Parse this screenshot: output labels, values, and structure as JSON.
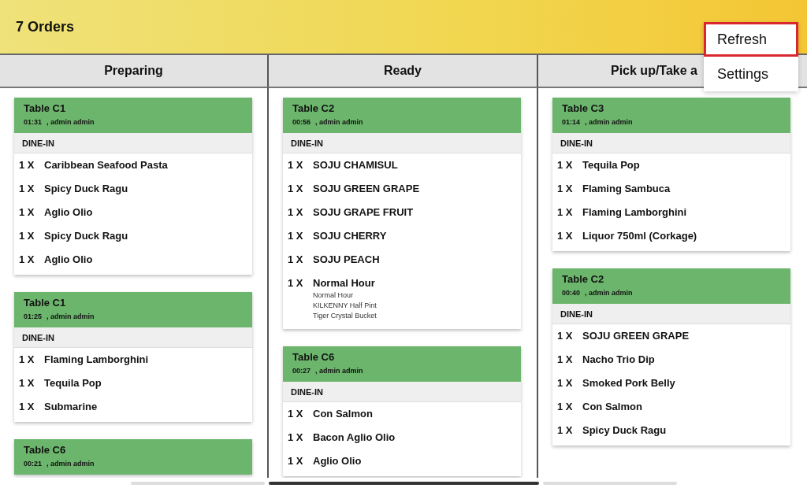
{
  "header": {
    "title": "7 Orders"
  },
  "menu": [
    {
      "label": "Refresh",
      "selected": true
    },
    {
      "label": "Settings",
      "selected": false
    }
  ],
  "columns": [
    {
      "heading": "Preparing",
      "orders": [
        {
          "table": "Table C1",
          "time": "01:31",
          "staff": ", admin admin",
          "type": "DINE-IN",
          "items": [
            {
              "qty": "1 X",
              "name": "Caribbean Seafood Pasta"
            },
            {
              "qty": "1 X",
              "name": "Spicy Duck Ragu"
            },
            {
              "qty": "1 X",
              "name": "Aglio Olio"
            },
            {
              "qty": "1 X",
              "name": "Spicy Duck Ragu"
            },
            {
              "qty": "1 X",
              "name": "Aglio Olio"
            }
          ]
        },
        {
          "table": "Table C1",
          "time": "01:25",
          "staff": ", admin admin",
          "type": "DINE-IN",
          "items": [
            {
              "qty": "1 X",
              "name": "Flaming Lamborghini"
            },
            {
              "qty": "1 X",
              "name": "Tequila Pop"
            },
            {
              "qty": "1 X",
              "name": "Submarine"
            }
          ]
        },
        {
          "table": "Table C6",
          "time": "00:21",
          "staff": ", admin admin"
        }
      ]
    },
    {
      "heading": "Ready",
      "orders": [
        {
          "table": "Table C2",
          "time": "00:56",
          "staff": ", admin admin",
          "type": "DINE-IN",
          "items": [
            {
              "qty": "1 X",
              "name": "SOJU CHAMISUL"
            },
            {
              "qty": "1 X",
              "name": "SOJU GREEN GRAPE"
            },
            {
              "qty": "1 X",
              "name": "SOJU GRAPE FRUIT"
            },
            {
              "qty": "1 X",
              "name": "SOJU CHERRY"
            },
            {
              "qty": "1 X",
              "name": "SOJU PEACH"
            },
            {
              "qty": "1 X",
              "name": "Normal Hour",
              "details": [
                "Normal Hour",
                "KILKENNY Half Pint",
                "Tiger Crystal Bucket"
              ]
            }
          ]
        },
        {
          "table": "Table C6",
          "time": "00:27",
          "staff": ", admin admin",
          "type": "DINE-IN",
          "items": [
            {
              "qty": "1 X",
              "name": "Con Salmon"
            },
            {
              "qty": "1 X",
              "name": "Bacon Aglio Olio"
            },
            {
              "qty": "1 X",
              "name": "Aglio Olio"
            }
          ]
        }
      ]
    },
    {
      "heading": "Pick up/Take a",
      "orders": [
        {
          "table": "Table C3",
          "time": "01:14",
          "staff": ", admin admin",
          "type": "DINE-IN",
          "items": [
            {
              "qty": "1 X",
              "name": "Tequila Pop"
            },
            {
              "qty": "1 X",
              "name": "Flaming Sambuca"
            },
            {
              "qty": "1 X",
              "name": "Flaming Lamborghini"
            },
            {
              "qty": "1 X",
              "name": "Liquor 750ml (Corkage)"
            }
          ]
        },
        {
          "table": "Table C2",
          "time": "00:40",
          "staff": ", admin admin",
          "type": "DINE-IN",
          "items": [
            {
              "qty": "1 X",
              "name": "SOJU GREEN GRAPE"
            },
            {
              "qty": "1 X",
              "name": "Nacho Trio Dip"
            },
            {
              "qty": "1 X",
              "name": "Smoked Pork Belly"
            },
            {
              "qty": "1 X",
              "name": "Con Salmon"
            },
            {
              "qty": "1 X",
              "name": "Spicy Duck Ragu"
            }
          ]
        }
      ]
    }
  ]
}
